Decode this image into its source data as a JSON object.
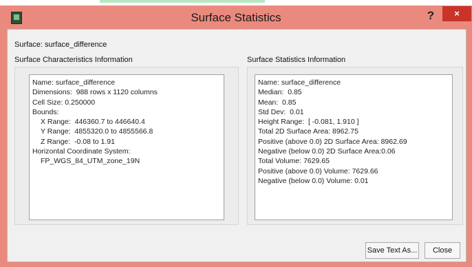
{
  "window": {
    "title": "Surface Statistics",
    "help_label": "?",
    "close_label": "×"
  },
  "surface": {
    "label": "Surface:",
    "value": "surface_difference"
  },
  "left_group": {
    "title": "Surface Characteristics Information",
    "lines": [
      "Name: surface_difference",
      "Dimensions:  988 rows x 1120 columns",
      "Cell Size: 0.250000",
      "Bounds:",
      "X Range:  446360.7 to 446640.4",
      "Y Range:  4855320.0 to 4855566.8",
      "Z Range:  -0.08 to 1.91",
      "Horizontal Coordinate System:",
      "FP_WGS_84_UTM_zone_19N"
    ]
  },
  "right_group": {
    "title": "Surface Statistics Information",
    "lines": [
      "Name: surface_difference",
      "Median:  0.85",
      "Mean:  0.85",
      "Std Dev:  0.01",
      "Height Range:  [ -0.081, 1.910 ]",
      "Total 2D Surface Area: 8962.75",
      "Positive (above 0.0) 2D Surface Area: 8962.69",
      "Negative (below 0.0) 2D Surface Area:0.06",
      "Total Volume: 7629.65",
      "Positive (above 0.0) Volume: 7629.66",
      "Negative (below 0.0) Volume: 0.01"
    ]
  },
  "buttons": {
    "save_text": "Save Text As...",
    "close": "Close"
  }
}
